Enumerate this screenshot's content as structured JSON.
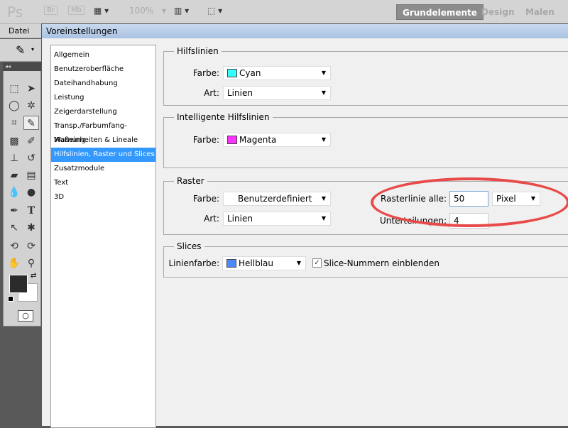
{
  "topbar": {
    "logo": "Ps",
    "br": "Br",
    "mb": "Mb",
    "zoom": "100%",
    "workspaces": [
      "Grundelemente",
      "Design",
      "Malen"
    ],
    "active_workspace": "Grundelemente"
  },
  "menu": {
    "datei": "Datei"
  },
  "dialog": {
    "title": "Voreinstellungen",
    "nav": [
      "Allgemein",
      "Benutzeroberfläche",
      "Dateihandhabung",
      "Leistung",
      "Zeigerdarstellung",
      "Transp./Farbumfang-Warnung",
      "Maßeinheiten & Lineale",
      "Hilfslinien, Raster und Slices",
      "Zusatzmodule",
      "Text",
      "3D"
    ],
    "selected_index": 7,
    "hilfslinien": {
      "title": "Hilfslinien",
      "farbe_label": "Farbe:",
      "farbe": "Cyan",
      "farbe_color": "#33ffff",
      "art_label": "Art:",
      "art": "Linien"
    },
    "smart": {
      "title": "Intelligente Hilfslinien",
      "farbe_label": "Farbe:",
      "farbe": "Magenta",
      "farbe_color": "#ff33ff"
    },
    "raster": {
      "title": "Raster",
      "farbe_label": "Farbe:",
      "farbe": "Benutzerdefiniert",
      "art_label": "Art:",
      "art": "Linien",
      "rasterlinie_label": "Rasterlinie alle:",
      "rasterlinie": "50",
      "einheit": "Pixel",
      "unterteilungen_label": "Unterteilungen:",
      "unterteilungen": "4"
    },
    "slices": {
      "title": "Slices",
      "linienfarbe_label": "Linienfarbe:",
      "linienfarbe": "Hellblau",
      "linienfarbe_color": "#4d88ff",
      "nummern_label": "Slice-Nummern einblenden",
      "nummern_checked": true
    }
  },
  "colors": {
    "highlight": "#e84a4a",
    "selection": "#3399ff"
  }
}
